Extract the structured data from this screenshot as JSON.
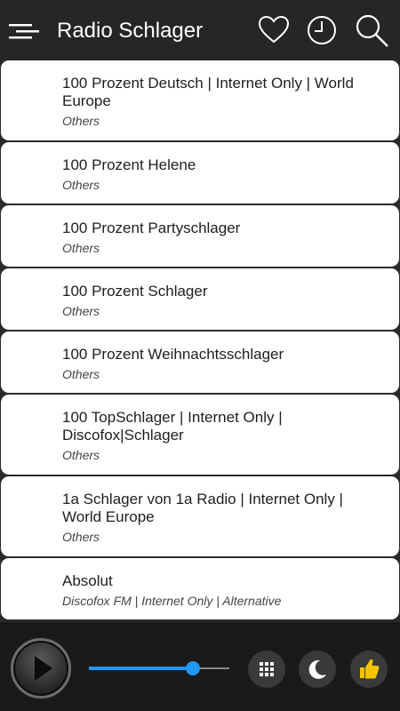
{
  "app_bar": {
    "title": "Radio Schlager",
    "icons": [
      "menu-icon",
      "heart-icon",
      "clock-icon",
      "search-icon"
    ]
  },
  "stations": [
    {
      "name": "100 Prozent Deutsch | Internet Only | World Europe",
      "genre": "Others"
    },
    {
      "name": "100 Prozent Helene",
      "genre": "Others"
    },
    {
      "name": "100 Prozent Partyschlager",
      "genre": "Others"
    },
    {
      "name": "100 Prozent Schlager",
      "genre": "Others"
    },
    {
      "name": "100 Prozent Weihnachtsschlager",
      "genre": "Others"
    },
    {
      "name": "100 TopSchlager | Internet Only | Discofox|Schlager",
      "genre": "Others"
    },
    {
      "name": "1a Schlager von 1a Radio | Internet Only | World Europe",
      "genre": "Others"
    },
    {
      "name": "Absolut",
      "genre": "Discofox FM | Internet Only | Alternative"
    }
  ],
  "player": {
    "volume": 0.74,
    "icons": [
      "play-icon",
      "grid-icon",
      "moon-icon",
      "thumbs-up-icon"
    ]
  },
  "colors": {
    "app_bar": "#262626",
    "background": "#2a2a2a",
    "accent": "#2196f3",
    "thumb": "#f5c400"
  }
}
